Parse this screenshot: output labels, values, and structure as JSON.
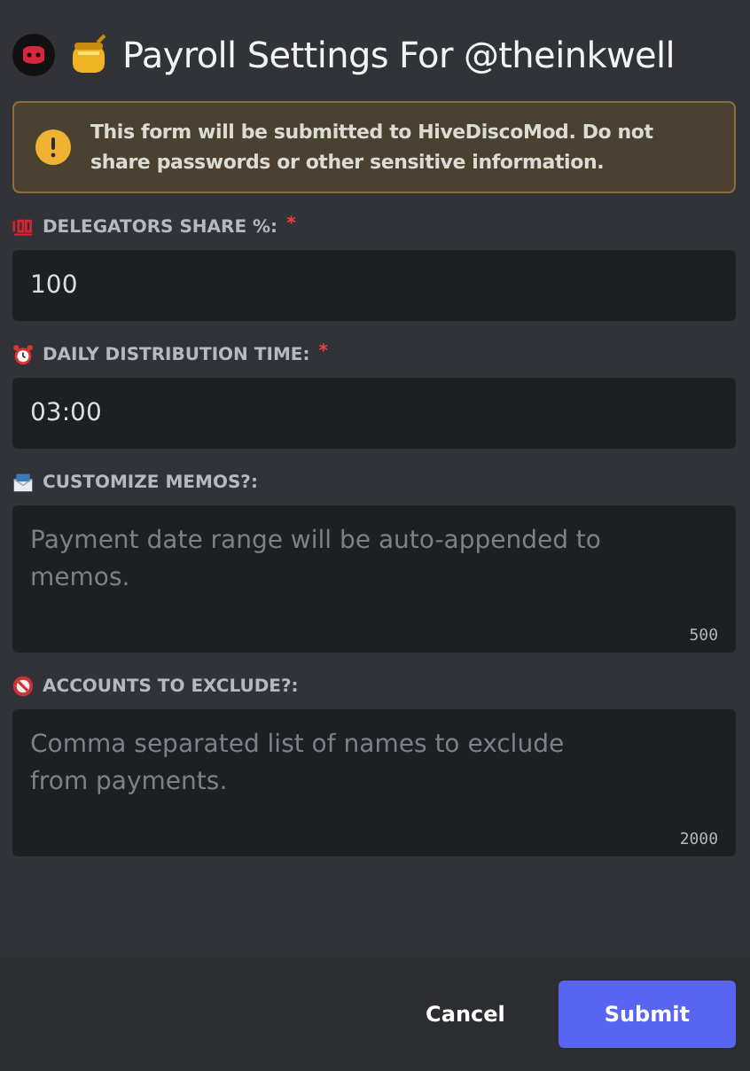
{
  "modal": {
    "title": "Payroll Settings For @theinkwell"
  },
  "warning": {
    "text": "This form will be submitted to HiveDiscoMod. Do not share passwords or other sensitive information."
  },
  "fields": [
    {
      "kind": "text",
      "label": "DELEGATORS SHARE %:",
      "required_mark": "*",
      "value": "100"
    },
    {
      "kind": "text",
      "label": "DAILY DISTRIBUTION TIME:",
      "required_mark": "*",
      "value": "03:00"
    },
    {
      "kind": "textarea",
      "label": "CUSTOMIZE MEMOS?:",
      "placeholder": "Payment date range will be auto-appended to memos.",
      "counter": "500"
    },
    {
      "kind": "textarea",
      "label": "ACCOUNTS TO EXCLUDE?:",
      "placeholder": "Comma separated list of names to exclude from payments.",
      "counter": "2000"
    }
  ],
  "buttons": [
    {
      "kind": "link",
      "label": "Cancel"
    },
    {
      "kind": "primary",
      "label": "Submit"
    }
  ]
}
